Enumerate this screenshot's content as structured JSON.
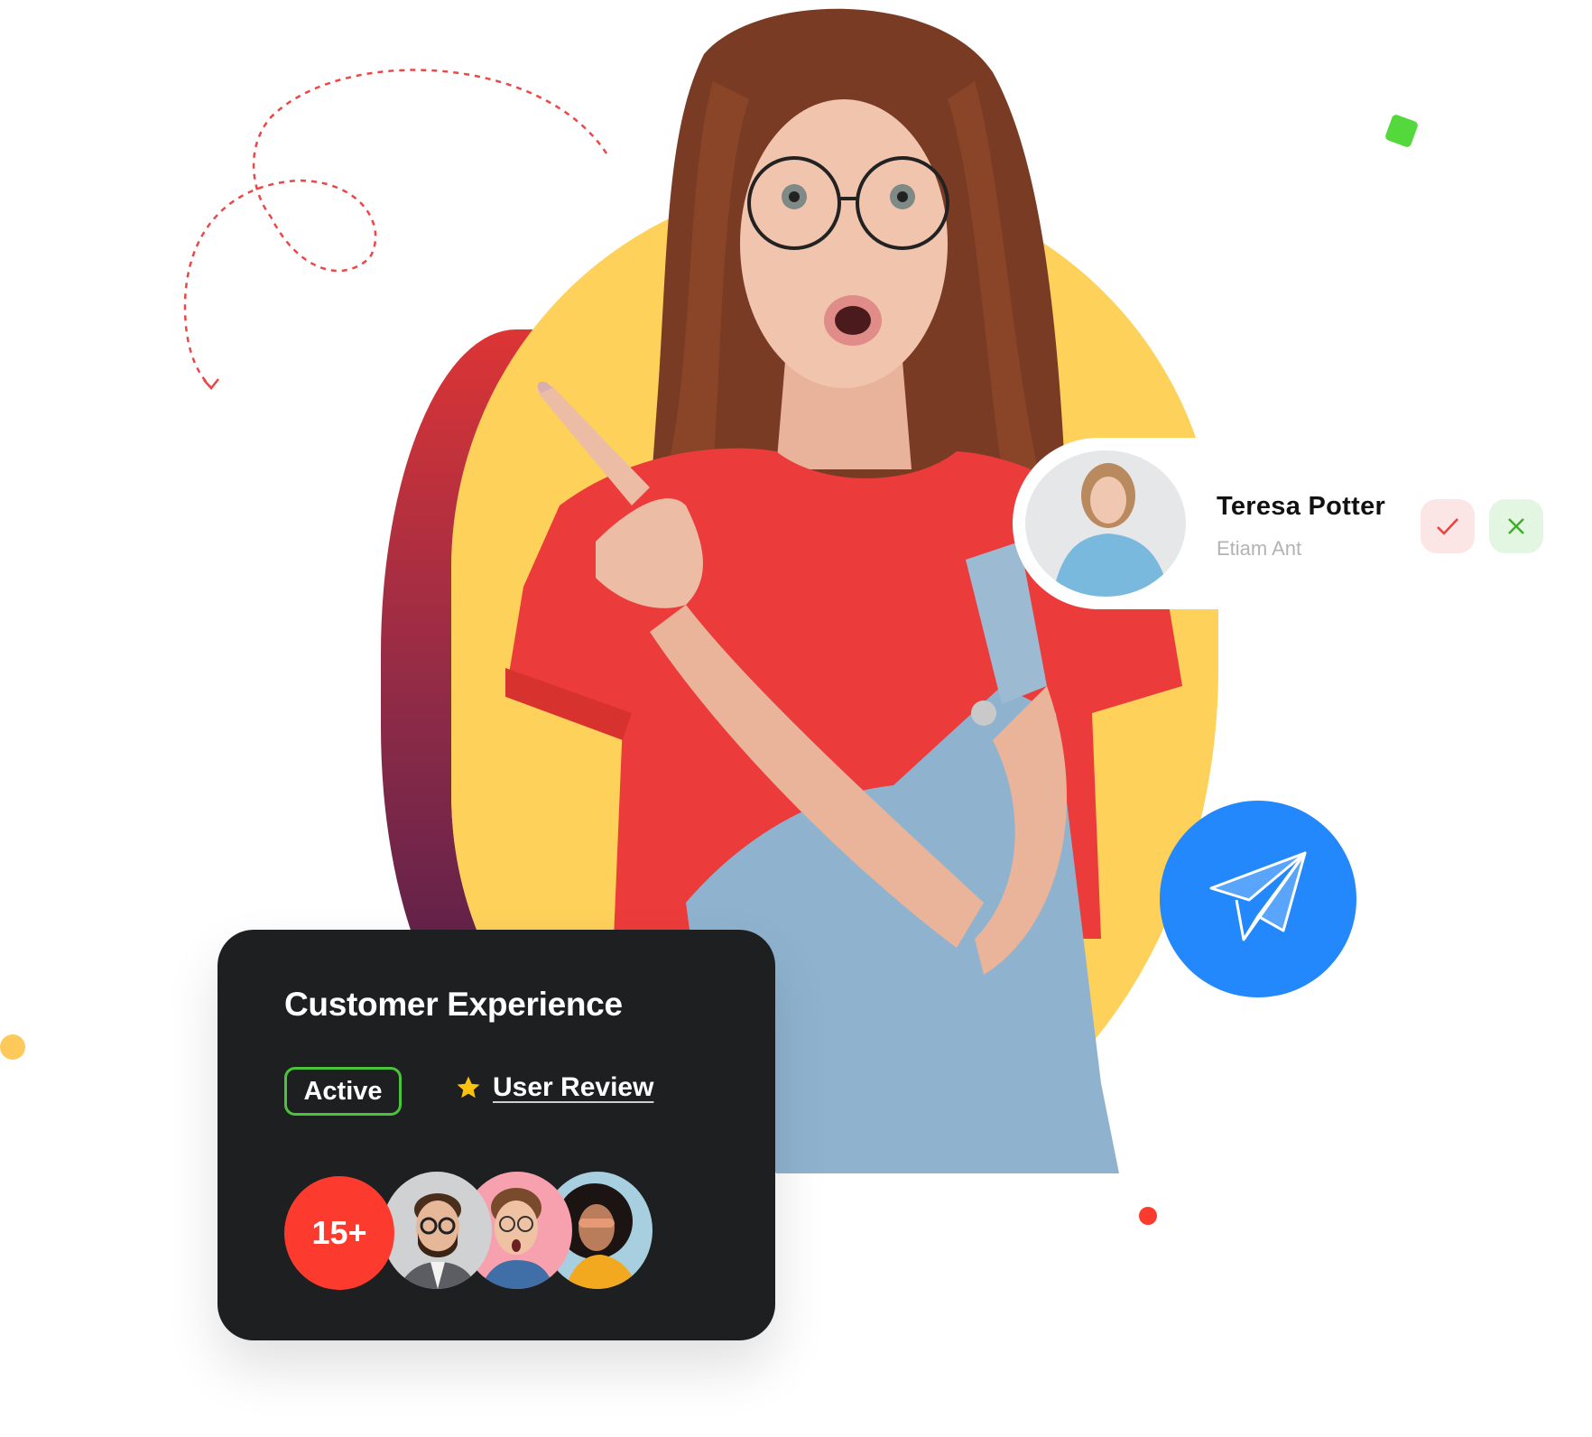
{
  "profile": {
    "name": "Teresa Potter",
    "role": "Etiam Ant",
    "accept_icon": "check-icon",
    "reject_icon": "close-icon"
  },
  "send": {
    "icon": "paper-plane-icon"
  },
  "card": {
    "title": "Customer Experience",
    "status_badge": "Active",
    "review_icon": "star-icon",
    "review_label": "User Review",
    "avatar_count": "15+",
    "avatars": [
      "bearded-man-with-glasses",
      "surprised-man-with-glasses",
      "woman-with-curly-hair-sunglasses"
    ]
  },
  "colors": {
    "yellow": "#fdd15a",
    "gradient_top": "#dc3535",
    "gradient_bottom": "#4e1e4a",
    "blue": "#2388fb",
    "green": "#4ac53a",
    "red": "#fb3b2e",
    "dark_card": "#1e1f21",
    "accept_bg": "#fbe5e5",
    "reject_bg": "#e3f6e1"
  }
}
